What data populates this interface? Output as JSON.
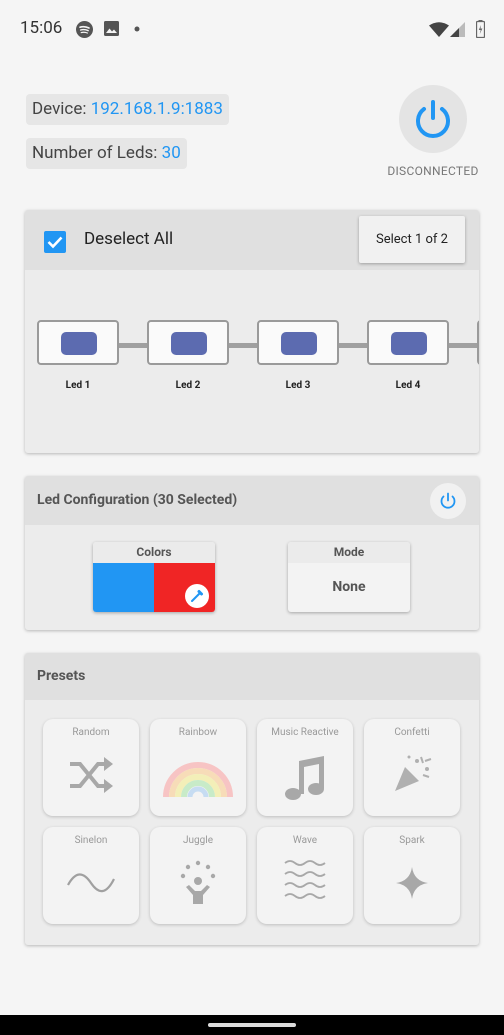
{
  "status_bar": {
    "time": "15:06"
  },
  "device": {
    "label": "Device:",
    "address": "192.168.1.9:1883"
  },
  "leds_count": {
    "label": "Number of Leds:",
    "value": "30"
  },
  "connection": {
    "status": "DISCONNECTED"
  },
  "selection": {
    "deselect_label": "Deselect All",
    "select_page_label": "Select 1 of 2",
    "leds": [
      "Led 1",
      "Led 2",
      "Led 3",
      "Led 4"
    ]
  },
  "config": {
    "title": "Led Configuration (30 Selected)",
    "colors_label": "Colors",
    "color_left": "#2196f3",
    "color_right": "#f02525",
    "mode_label": "Mode",
    "mode_value": "None"
  },
  "presets": {
    "title": "Presets",
    "items": [
      {
        "label": "Random",
        "icon": "shuffle-icon"
      },
      {
        "label": "Rainbow",
        "icon": "rainbow-icon"
      },
      {
        "label": "Music Reactive",
        "icon": "music-note-icon"
      },
      {
        "label": "Confetti",
        "icon": "confetti-icon"
      },
      {
        "label": "Sinelon",
        "icon": "sine-wave-icon"
      },
      {
        "label": "Juggle",
        "icon": "juggle-icon"
      },
      {
        "label": "Wave",
        "icon": "wave-icon"
      },
      {
        "label": "Spark",
        "icon": "sparkle-icon"
      }
    ]
  }
}
